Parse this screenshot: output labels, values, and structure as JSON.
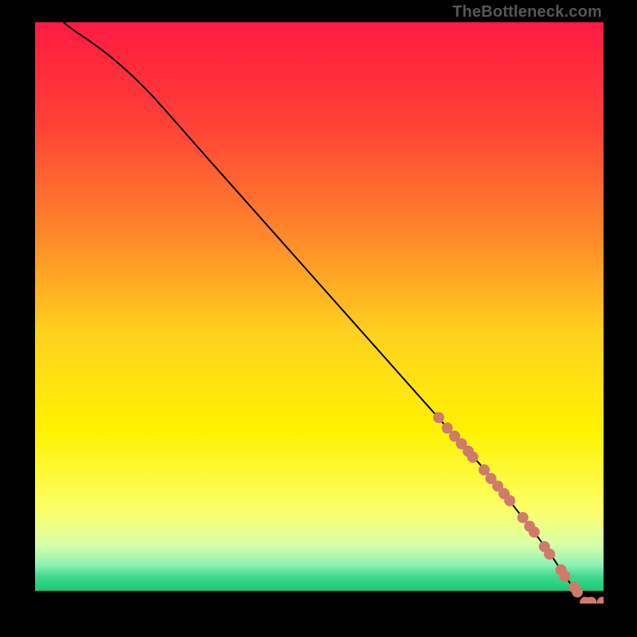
{
  "watermark": "TheBottleneck.com",
  "chart_data": {
    "type": "line",
    "title": "",
    "xlabel": "",
    "ylabel": "",
    "xlim": [
      0,
      100
    ],
    "ylim": [
      0,
      100
    ],
    "grid": false,
    "legend": false,
    "gradient_stops": [
      {
        "pos": 0.0,
        "color": "#ff1a41"
      },
      {
        "pos": 0.18,
        "color": "#ff4136"
      },
      {
        "pos": 0.38,
        "color": "#ff8a2a"
      },
      {
        "pos": 0.55,
        "color": "#ffd21e"
      },
      {
        "pos": 0.72,
        "color": "#fff200"
      },
      {
        "pos": 0.86,
        "color": "#fcff6a"
      },
      {
        "pos": 0.92,
        "color": "#d6ffa8"
      },
      {
        "pos": 0.955,
        "color": "#8cf0b4"
      },
      {
        "pos": 0.975,
        "color": "#3fd98f"
      },
      {
        "pos": 1.0,
        "color": "#17c977"
      }
    ],
    "series": [
      {
        "name": "bottleneck-curve",
        "x": [
          5,
          7,
          10,
          14,
          20,
          30,
          40,
          50,
          60,
          70,
          75,
          80,
          84,
          88,
          91,
          93,
          95,
          97,
          99,
          100
        ],
        "y": [
          100,
          98.5,
          96.5,
          93.5,
          88,
          77,
          66,
          55,
          44,
          33,
          27.5,
          22,
          17,
          12,
          8,
          5,
          2.5,
          1,
          0.3,
          0.2
        ]
      }
    ],
    "markers": {
      "name": "bottleneck-points",
      "color": "#d07a6c",
      "radius_px": 7,
      "points": [
        {
          "x": 71.0,
          "y": 32.0
        },
        {
          "x": 72.5,
          "y": 30.2
        },
        {
          "x": 73.8,
          "y": 28.8
        },
        {
          "x": 75.0,
          "y": 27.5
        },
        {
          "x": 76.2,
          "y": 26.2
        },
        {
          "x": 77.0,
          "y": 25.2
        },
        {
          "x": 79.0,
          "y": 23.0
        },
        {
          "x": 80.2,
          "y": 21.5
        },
        {
          "x": 81.4,
          "y": 20.2
        },
        {
          "x": 82.5,
          "y": 18.9
        },
        {
          "x": 83.5,
          "y": 17.7
        },
        {
          "x": 85.8,
          "y": 14.8
        },
        {
          "x": 87.0,
          "y": 13.3
        },
        {
          "x": 87.8,
          "y": 12.3
        },
        {
          "x": 89.6,
          "y": 9.8
        },
        {
          "x": 90.5,
          "y": 8.5
        },
        {
          "x": 92.5,
          "y": 5.8
        },
        {
          "x": 93.2,
          "y": 4.7
        },
        {
          "x": 94.8,
          "y": 2.8
        },
        {
          "x": 95.4,
          "y": 2.0
        },
        {
          "x": 96.8,
          "y": 0.2
        },
        {
          "x": 97.8,
          "y": 0.2
        },
        {
          "x": 99.8,
          "y": 0.2
        }
      ]
    }
  }
}
